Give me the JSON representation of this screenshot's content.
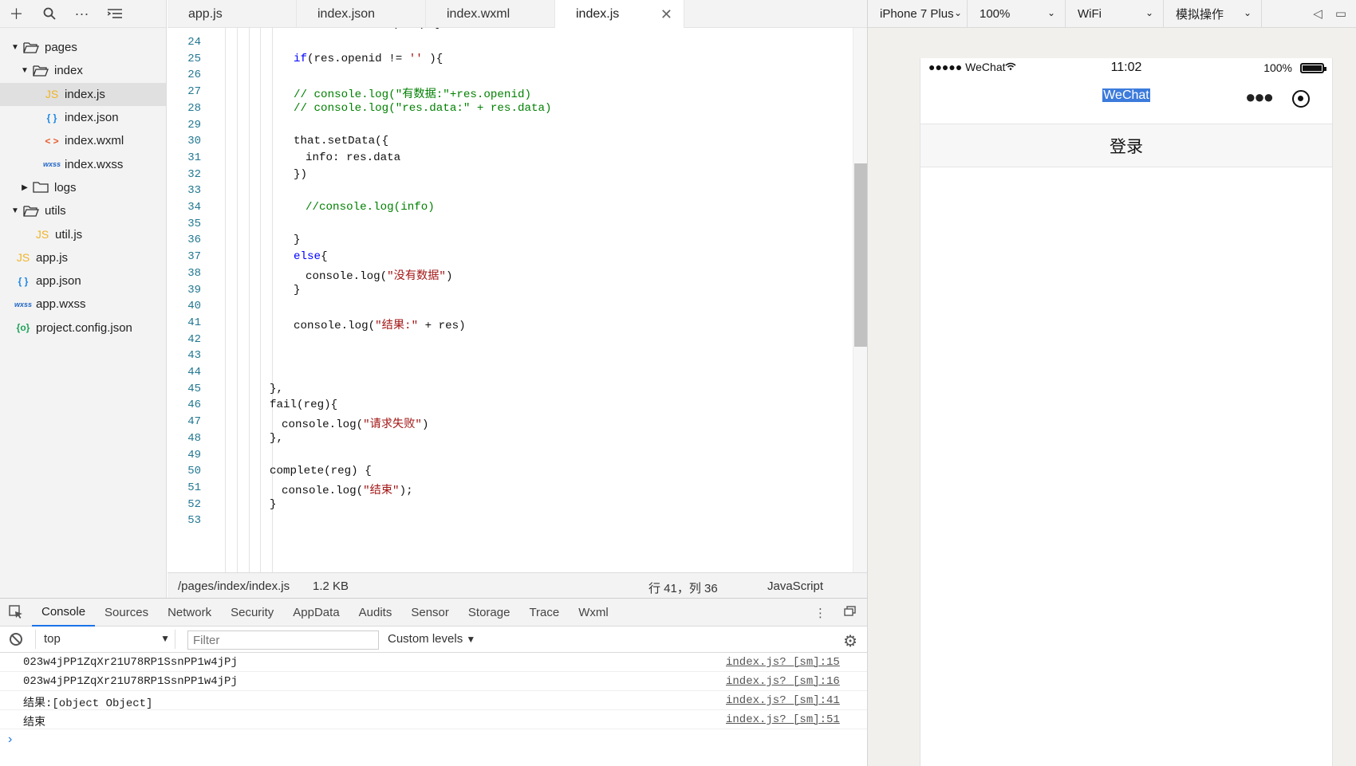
{
  "sidebar": {
    "toolbar_icons": [
      "plus-icon",
      "search-icon",
      "more-icon",
      "outline-icon"
    ],
    "tree": [
      {
        "label": "pages",
        "type": "folder",
        "open": true,
        "depth": 0
      },
      {
        "label": "index",
        "type": "folder",
        "open": true,
        "depth": 1
      },
      {
        "label": "index.js",
        "type": "js",
        "depth": 2,
        "active": true
      },
      {
        "label": "index.json",
        "type": "json",
        "depth": 2
      },
      {
        "label": "index.wxml",
        "type": "wxml",
        "depth": 2
      },
      {
        "label": "index.wxss",
        "type": "wxss",
        "depth": 2
      },
      {
        "label": "logs",
        "type": "folder",
        "open": false,
        "depth": 1
      },
      {
        "label": "utils",
        "type": "folder",
        "open": true,
        "depth": 0
      },
      {
        "label": "util.js",
        "type": "js",
        "depth": 1
      },
      {
        "label": "app.js",
        "type": "js",
        "depth": 0
      },
      {
        "label": "app.json",
        "type": "json",
        "depth": 0
      },
      {
        "label": "app.wxss",
        "type": "wxss",
        "depth": 0
      },
      {
        "label": "project.config.json",
        "type": "cfg",
        "depth": 0
      }
    ],
    "icon_glyphs": {
      "js": "JS",
      "json": "{ }",
      "wxml": "< >",
      "wxss": "wxss",
      "cfg": "{o}"
    }
  },
  "editor": {
    "tabs": [
      "app.js",
      "index.json",
      "index.wxml",
      "index.js"
    ],
    "active_tab": "index.js",
    "line_numbers": [
      "24",
      "25",
      "26",
      "27",
      "28",
      "29",
      "30",
      "31",
      "32",
      "33",
      "34",
      "35",
      "36",
      "37",
      "38",
      "39",
      "40",
      "41",
      "42",
      "43",
      "44",
      "45",
      "46",
      "47",
      "48",
      "49",
      "50",
      "51",
      "52",
      "53"
    ],
    "code_lines": [
      [],
      [
        {
          "t": "if",
          "c": "kw"
        },
        {
          "t": "(res.openid != "
        },
        {
          "t": "''",
          "c": "str"
        },
        {
          "t": " ){"
        }
      ],
      [],
      [
        {
          "t": "// console.log(\"有数据:\"+res.openid)",
          "c": "cm"
        }
      ],
      [
        {
          "t": "// console.log(\"res.data:\" + res.data)",
          "c": "cm"
        }
      ],
      [],
      [
        {
          "t": "that.setData({"
        }
      ],
      [
        {
          "t": "info: res.data"
        }
      ],
      [
        {
          "t": "})"
        }
      ],
      [],
      [
        {
          "t": "//console.log(info)",
          "c": "cm"
        }
      ],
      [],
      [
        {
          "t": "}"
        }
      ],
      [
        {
          "t": "else",
          "c": "kw"
        },
        {
          "t": "{"
        }
      ],
      [
        {
          "t": "console.log("
        },
        {
          "t": "\"没有数据\"",
          "c": "str"
        },
        {
          "t": ")"
        }
      ],
      [
        {
          "t": "}"
        }
      ],
      [],
      [
        {
          "t": "console.log("
        },
        {
          "t": "\"结果:\"",
          "c": "str"
        },
        {
          "t": " + res)"
        }
      ],
      [],
      [],
      [],
      [
        {
          "t": "},"
        }
      ],
      [
        {
          "t": "fail(reg){"
        }
      ],
      [
        {
          "t": "console.log("
        },
        {
          "t": "\"请求失败\"",
          "c": "str"
        },
        {
          "t": ")"
        }
      ],
      [
        {
          "t": "},"
        }
      ],
      [],
      [
        {
          "t": "complete(reg) {"
        }
      ],
      [
        {
          "t": "console.log("
        },
        {
          "t": "\"结束\"",
          "c": "str"
        },
        {
          "t": ");"
        }
      ],
      [
        {
          "t": "}"
        }
      ],
      []
    ],
    "partial_top_line": [
      {
        "t": "success: "
      },
      {
        "t": "function",
        "c": "kw"
      },
      {
        "t": " (res) {"
      }
    ],
    "status": {
      "path": "/pages/index/index.js",
      "size": "1.2 KB",
      "cursor": "行 41，列 36",
      "language": "JavaScript"
    }
  },
  "devtools": {
    "tabs": [
      "Console",
      "Sources",
      "Network",
      "Security",
      "AppData",
      "Audits",
      "Sensor",
      "Storage",
      "Trace",
      "Wxml"
    ],
    "active_tab": "Console",
    "context": "top",
    "filter_placeholder": "Filter",
    "levels": "Custom levels",
    "messages": [
      {
        "text": "023w4jPP1ZqXr21U78RP1SsnPP1w4jPj",
        "source": "index.js? [sm]:15"
      },
      {
        "text": "023w4jPP1ZqXr21U78RP1SsnPP1w4jPj",
        "source": "index.js? [sm]:16"
      },
      {
        "text": "结果:[object Object]",
        "source": "index.js? [sm]:41"
      },
      {
        "text": "结束",
        "source": "index.js? [sm]:51"
      }
    ]
  },
  "simulator": {
    "device": "iPhone 7 Plus",
    "zoom": "100%",
    "network": "WiFi",
    "action": "模拟操作",
    "status": {
      "carrier": "●●●●● WeChat",
      "time": "11:02",
      "battery": "100%"
    },
    "nav_title": "WeChat",
    "login_button": "登录"
  }
}
